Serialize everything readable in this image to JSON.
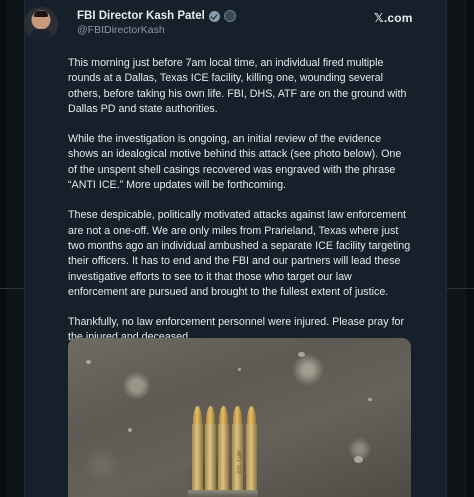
{
  "tweet": {
    "author_name": "FBI Director Kash Patel",
    "handle": "@FBIDirectorKash",
    "platform_logo": "𝕏.com",
    "paragraphs": [
      "This morning just before 7am local time, an individual fired multiple rounds at a Dallas, Texas ICE facility, killing one, wounding several others, before taking his own life. FBI, DHS, ATF are on the ground with Dallas PD and state authorities.",
      "While the investigation is ongoing, an initial review of the evidence shows an idealogical motive behind this attack (see photo below). One of the unspent shell casings recovered was engraved with the phrase “ANTI ICE.” More updates will be forthcoming.",
      "These despicable, politically motivated attacks against law enforcement are not a one-off. We are only miles from Prarieland, Texas where just two months ago an individual ambushed a separate ICE facility targeting their officers. It has to end and the FBI and our partners will lead these investigative efforts to see to it that those who target our law enforcement are pursued and brought to the fullest extent of justice.",
      "Thankfully, no law enforcement personnel were injured. Please pray for the injured and deceased."
    ],
    "media_engraving": "ANTI ICE"
  },
  "icons": {
    "verified": "gov-verified-badge-icon",
    "affiliate": "flag-affiliate-icon",
    "avatar": "profile-photo"
  },
  "colors": {
    "background": "#15202b",
    "text": "#e7e9ea",
    "muted": "#8b98a5",
    "badge": "#829aab"
  }
}
